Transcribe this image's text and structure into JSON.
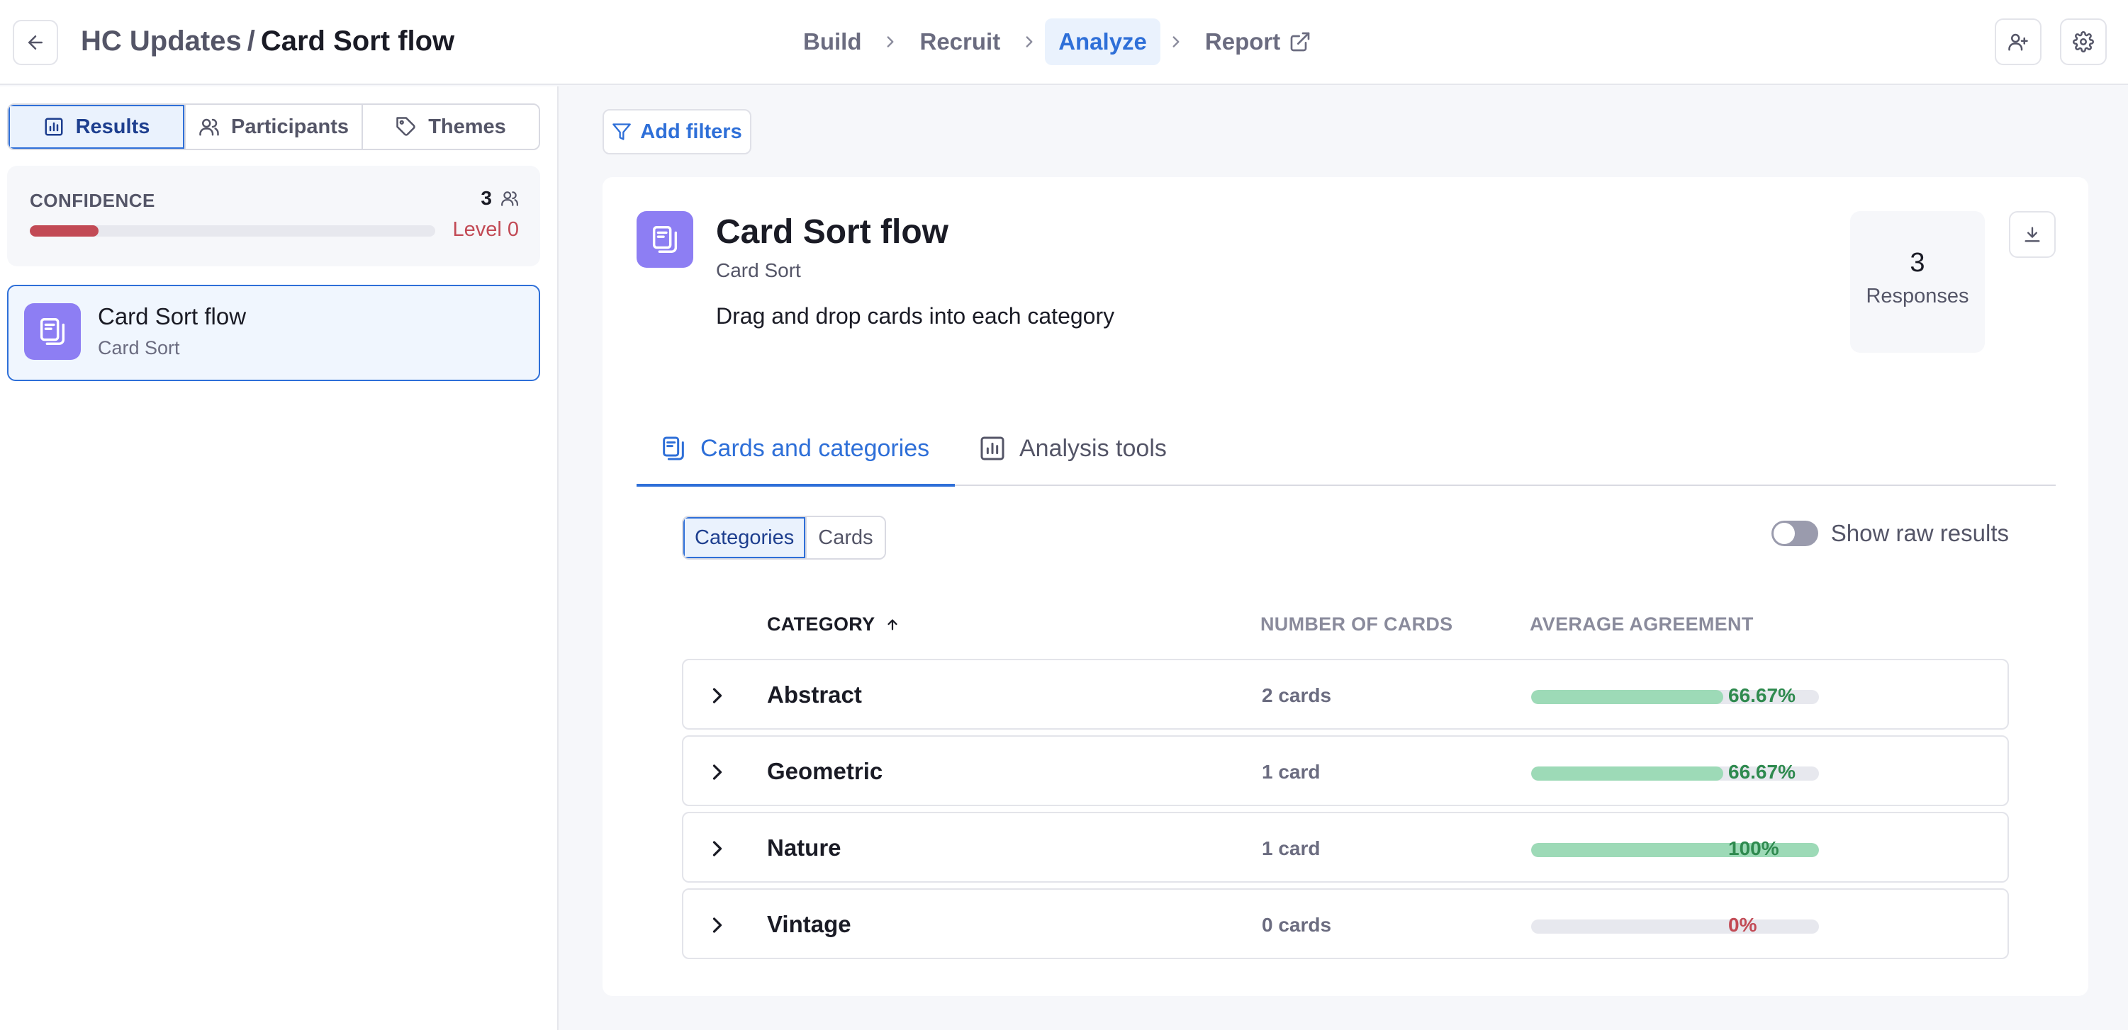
{
  "header": {
    "project": "HC Updates",
    "separator": "/",
    "title": "Card Sort flow",
    "steps": [
      {
        "label": "Build",
        "active": false
      },
      {
        "label": "Recruit",
        "active": false
      },
      {
        "label": "Analyze",
        "active": true
      },
      {
        "label": "Report",
        "active": false
      }
    ]
  },
  "sidebar": {
    "tabs": [
      {
        "label": "Results",
        "icon": "bar-chart-icon",
        "active": true
      },
      {
        "label": "Participants",
        "icon": "users-icon",
        "active": false
      },
      {
        "label": "Themes",
        "icon": "tag-icon",
        "active": false
      }
    ],
    "confidence": {
      "label": "CONFIDENCE",
      "count": "3",
      "level": "Level 0",
      "progress": 0.17
    },
    "flow_item": {
      "title": "Card Sort flow",
      "subtitle": "Card Sort"
    }
  },
  "main": {
    "add_filters": "Add filters",
    "task": {
      "title": "Card Sort flow",
      "type": "Card Sort",
      "description": "Drag and drop cards into each category"
    },
    "responses": {
      "count": "3",
      "label": "Responses"
    },
    "tabs": [
      {
        "label": "Cards and categories",
        "active": true
      },
      {
        "label": "Analysis tools",
        "active": false
      }
    ],
    "view_toggle": [
      {
        "label": "Categories",
        "active": true
      },
      {
        "label": "Cards",
        "active": false
      }
    ],
    "raw_results_label": "Show raw results",
    "table": {
      "headers": {
        "category": "CATEGORY",
        "cards": "NUMBER OF CARDS",
        "agreement": "AVERAGE AGREEMENT"
      },
      "rows": [
        {
          "category": "Abstract",
          "cards": "2 cards",
          "agreement": 66.67,
          "agreement_label": "66.67%"
        },
        {
          "category": "Geometric",
          "cards": "1 card",
          "agreement": 66.67,
          "agreement_label": "66.67%"
        },
        {
          "category": "Nature",
          "cards": "1 card",
          "agreement": 100,
          "agreement_label": "100%"
        },
        {
          "category": "Vintage",
          "cards": "0 cards",
          "agreement": 0,
          "agreement_label": "0%"
        }
      ]
    }
  },
  "colors": {
    "accent": "#2e6fd8",
    "task_icon_bg": "#8d7ef3",
    "confidence_bar": "#c24a55",
    "agreement_fill": "#9ddab7",
    "positive_text": "#2f8a4f",
    "negative_text": "#c24a55"
  }
}
